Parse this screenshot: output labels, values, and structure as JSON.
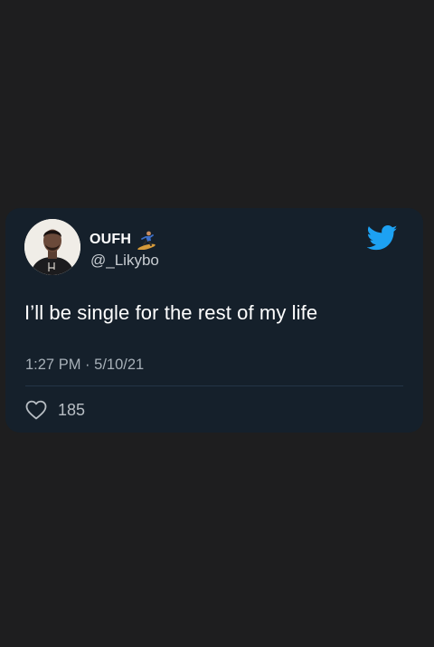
{
  "tweet": {
    "display_name": "OUFH",
    "name_emoji": "snowboarder-icon",
    "handle": "@_Likybo",
    "text": "I’ll be single for the rest of my life",
    "time": "1:27 PM",
    "separator": "·",
    "date": "5/10/21",
    "likes": "185"
  },
  "icons": {
    "brand": "twitter-bird-icon",
    "like": "heart-icon",
    "avatar": "profile-avatar"
  },
  "colors": {
    "page_background": "#1e1e1f",
    "card_background": "#15202b",
    "twitter_blue": "#1da1f2",
    "primary_text": "#ffffff",
    "secondary_text": "#a7b0b8"
  }
}
